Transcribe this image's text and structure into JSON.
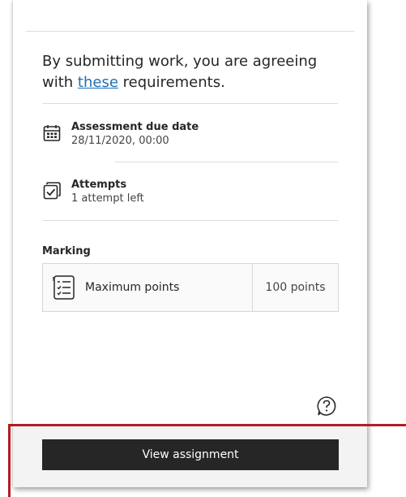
{
  "intro": {
    "text_before": "By submitting work, you are agreeing with ",
    "link_text": "these",
    "text_after": " requirements."
  },
  "due_date": {
    "title": "Assessment due date",
    "value": "28/11/2020, 00:00",
    "icon": "calendar-icon"
  },
  "attempts": {
    "title": "Attempts",
    "value": "1 attempt left",
    "icon": "checkbox-icon"
  },
  "marking": {
    "heading": "Marking",
    "label": "Maximum points",
    "value": "100 points",
    "icon": "rubric-list-icon"
  },
  "help": {
    "icon": "help-icon"
  },
  "footer": {
    "button_label": "View assignment"
  },
  "colors": {
    "link": "#1f6fb2",
    "button_bg": "#262626",
    "highlight": "#b01e23"
  }
}
